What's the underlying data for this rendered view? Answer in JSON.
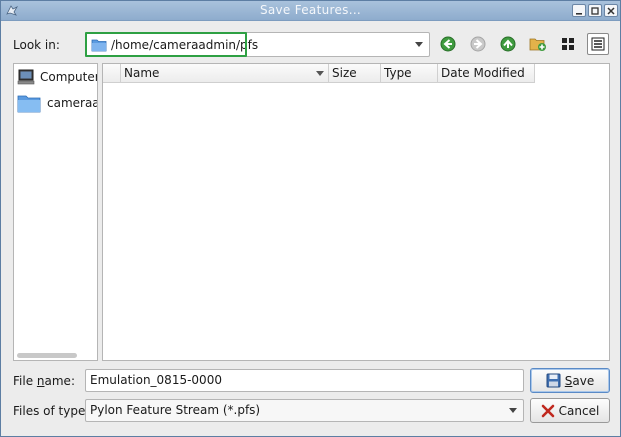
{
  "window": {
    "title": "Save Features..."
  },
  "toolbar": {
    "look_in_label": "Look in:",
    "path": "/home/cameraadmin/pfs",
    "buttons": [
      {
        "name": "back",
        "icon": "arrow-left-icon"
      },
      {
        "name": "forward",
        "icon": "arrow-right-icon"
      },
      {
        "name": "parent",
        "icon": "arrow-up-icon"
      },
      {
        "name": "new-folder",
        "icon": "new-folder-icon"
      },
      {
        "name": "list-view",
        "icon": "list-view-icon"
      },
      {
        "name": "detail-view",
        "icon": "detail-view-icon"
      }
    ]
  },
  "sidebar": {
    "items": [
      {
        "label": "Computer",
        "icon": "computer-icon"
      },
      {
        "label": "cameraadmin",
        "icon": "folder-icon"
      }
    ]
  },
  "file_list": {
    "columns": [
      "Name",
      "Size",
      "Type",
      "Date Modified"
    ],
    "rows": []
  },
  "form": {
    "file_name_label_pre": "File ",
    "file_name_label_mn": "n",
    "file_name_label_post": "ame:",
    "file_name_value": "Emulation_0815-0000",
    "file_type_label": "Files of type:",
    "file_type_value": "Pylon Feature Stream (*.pfs)",
    "save_mn": "S",
    "save_rest": "ave",
    "cancel_label": "Cancel"
  },
  "colors": {
    "title_bar": "#8eaccd",
    "highlight": "#2ea043",
    "accent": "#5a8ac6"
  }
}
